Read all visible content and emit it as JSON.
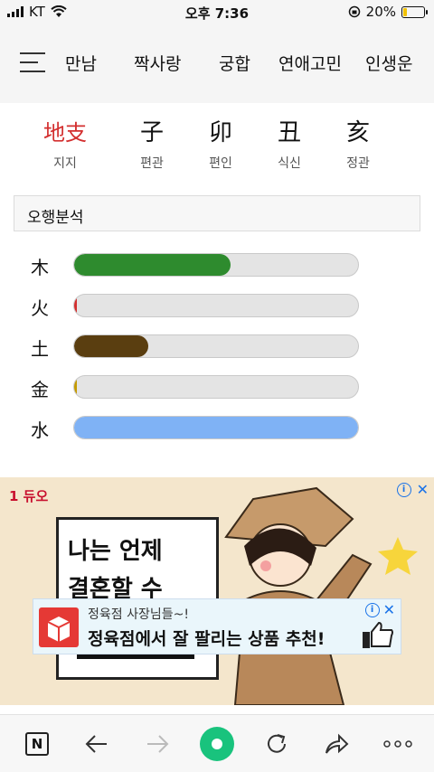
{
  "status": {
    "carrier": "KT",
    "time": "오후 7:36",
    "battery": "20%"
  },
  "nav": {
    "items": [
      "만남",
      "짝사랑",
      "궁합",
      "연애고민",
      "인생운"
    ]
  },
  "pillars": {
    "label_main": "地支",
    "label_sub": "지지",
    "items": [
      {
        "hanja": "子",
        "sub": "편관"
      },
      {
        "hanja": "卯",
        "sub": "편인"
      },
      {
        "hanja": "丑",
        "sub": "식신"
      },
      {
        "hanja": "亥",
        "sub": "정관"
      }
    ]
  },
  "section": {
    "title": "오행분석"
  },
  "ohaeng": [
    {
      "element": "木",
      "level": 0.55,
      "color": "#2e8b2e"
    },
    {
      "element": "火",
      "level": 0.01,
      "color": "#d32f2f"
    },
    {
      "element": "土",
      "level": 0.26,
      "color": "#5a3e10"
    },
    {
      "element": "金",
      "level": 0.01,
      "color": "#c49a00"
    },
    {
      "element": "水",
      "level": 1.0,
      "color": "#7fb2f5"
    }
  ],
  "ad": {
    "brand": "1 듀오",
    "sign_line1": "나는 언제",
    "sign_line2": "결혼할 수",
    "banner_small": "정육점 사장님들~!",
    "banner_big": "정육점에서 잘 팔리는 상품 추천!"
  },
  "toolbar": {
    "n_label": "N"
  }
}
